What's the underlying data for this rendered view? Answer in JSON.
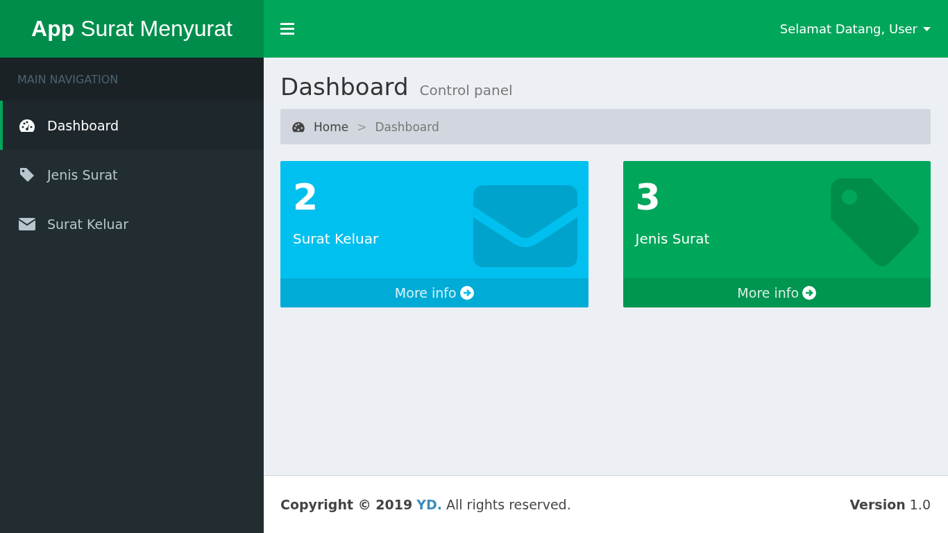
{
  "header": {
    "logo": "**App** Surat Menyurat",
    "user_menu": "Selamat Datang, User"
  },
  "sidebar": {
    "heading": "MAIN NAVIGATION",
    "items": [
      {
        "label": "Dashboard",
        "selected": true
      },
      {
        "label": "Jenis Surat",
        "selected": false
      },
      {
        "label": "Surat Keluar",
        "selected": false
      }
    ]
  },
  "page_header": {
    "title": "Dashboard",
    "subtitle": "Control panel"
  },
  "breadcrumb": {
    "separator": ">",
    "items": [
      {
        "label": "Home"
      },
      {
        "label": "Dashboard"
      }
    ]
  },
  "cards": [
    {
      "count": "2",
      "label": "Surat Keluar",
      "link": "More info",
      "color": "#00c0ef"
    },
    {
      "count": "3",
      "label": "Jenis Surat",
      "link": "More info",
      "color": "#00a65a"
    }
  ],
  "footer": {
    "copyright": "Copyright © 2019",
    "link": "YD.",
    "rights": "All rights reserved.",
    "version": "**Version** 1.0"
  }
}
